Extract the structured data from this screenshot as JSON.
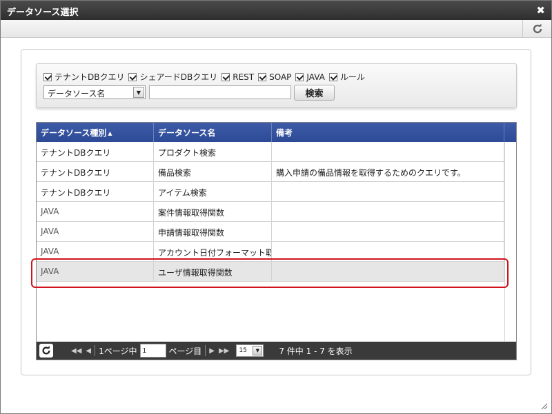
{
  "dialog": {
    "title": "データソース選択"
  },
  "filters": [
    {
      "label": "テナントDBクエリ",
      "checked": true
    },
    {
      "label": "シェアードDBクエリ",
      "checked": true
    },
    {
      "label": "REST",
      "checked": true
    },
    {
      "label": "SOAP",
      "checked": true
    },
    {
      "label": "JAVA",
      "checked": true
    },
    {
      "label": "ルール",
      "checked": true
    }
  ],
  "search": {
    "field_selected": "データソース名",
    "value": "",
    "button_label": "検索"
  },
  "grid": {
    "columns": [
      "データソース種別",
      "データソース名",
      "備考"
    ],
    "rows": [
      {
        "type": "テナントDBクエリ",
        "name": "プロダクト検索",
        "note": ""
      },
      {
        "type": "テナントDBクエリ",
        "name": "備品検索",
        "note": "購入申請の備品情報を取得するためのクエリです。"
      },
      {
        "type": "テナントDBクエリ",
        "name": "アイテム検索",
        "note": ""
      },
      {
        "type": "JAVA",
        "name": "案件情報取得関数",
        "note": ""
      },
      {
        "type": "JAVA",
        "name": "申請情報取得関数",
        "note": ""
      },
      {
        "type": "JAVA",
        "name": "アカウント日付フォーマット取得関数",
        "note": ""
      },
      {
        "type": "JAVA",
        "name": "ユーザ情報取得関数",
        "note": "",
        "selected": true
      }
    ]
  },
  "pager": {
    "current_page_prefix": "1ページ中",
    "page_value": "1",
    "page_suffix": "ページ目",
    "page_size": "15",
    "summary": "7 件中 1 - 7 を表示"
  },
  "colors": {
    "header_blue": "#2f4d98",
    "titlebar": "#3a3a3a",
    "highlight_red": "#d0121b"
  }
}
